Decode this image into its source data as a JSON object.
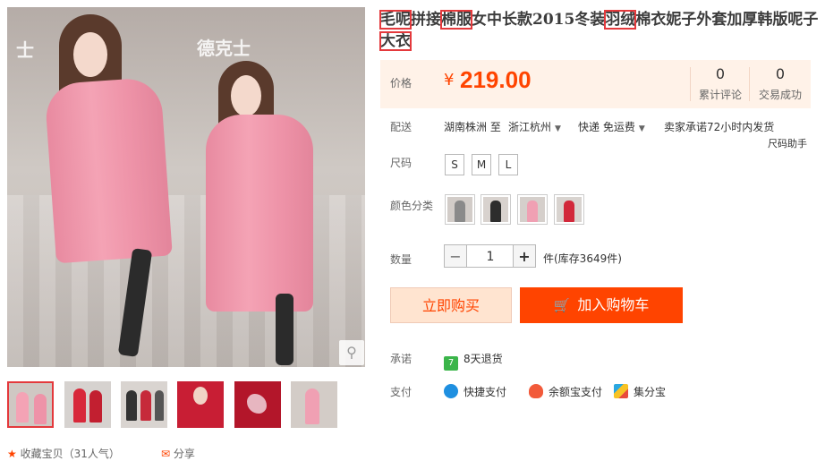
{
  "title": {
    "segments": [
      {
        "text": "毛呢",
        "highlight": true
      },
      {
        "text": "拼接",
        "highlight": false
      },
      {
        "text": "棉服",
        "highlight": true
      },
      {
        "text": "女中长款2015冬装",
        "highlight": false
      },
      {
        "text": "羽绒",
        "highlight": true
      },
      {
        "text": "棉衣妮子外套加厚韩版呢子",
        "highlight": false
      },
      {
        "text": "大衣",
        "highlight": true
      }
    ]
  },
  "price": {
    "label": "价格",
    "currency": "¥",
    "value": "219.00",
    "stats": [
      {
        "num": "0",
        "label": "累计评论"
      },
      {
        "num": "0",
        "label": "交易成功"
      }
    ]
  },
  "delivery": {
    "label": "配送",
    "from": "湖南株洲 至",
    "to": "浙江杭州",
    "method": "快递 免运费",
    "promise": "卖家承诺72小时内发货",
    "size_helper": "尺码助手"
  },
  "size": {
    "label": "尺码",
    "options": [
      "S",
      "M",
      "L"
    ]
  },
  "color": {
    "label": "颜色分类",
    "option_icons": [
      "grey-coat-thumb",
      "black-coat-thumb",
      "pink-coat-thumb",
      "red-coat-thumb"
    ]
  },
  "quantity": {
    "label": "数量",
    "minus": "−",
    "value": "1",
    "plus": "+",
    "stock": "件(库存3649件)"
  },
  "actions": {
    "buy_now": "立即购买",
    "add_to_cart": "加入购物车"
  },
  "promise": {
    "label": "承诺",
    "items": [
      "8天退货"
    ]
  },
  "payment": {
    "label": "支付",
    "items": [
      "快捷支付",
      "余额宝支付",
      "集分宝"
    ]
  },
  "gallery": {
    "thumb_icons": [
      "pink-coat-photo",
      "red-coat-photo",
      "black-coat-photo",
      "red-coat-detail",
      "embroidery-detail",
      "pink-coat-side"
    ]
  },
  "bottom": {
    "favorite": "收藏宝贝（31人气）",
    "share": "分享"
  },
  "colors": {
    "accent": "#ff4400",
    "price_bg": "#fff2e8",
    "highlight_box": "#e4393c",
    "coat_pink": "#f4a3b5"
  }
}
